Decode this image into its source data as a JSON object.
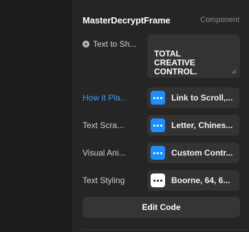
{
  "header": {
    "frame_name": "MasterDecryptFrame",
    "frame_type": "Component"
  },
  "text_row": {
    "label": "Text to Sh...",
    "value": "TOTAL\nCREATIVE\nCONTROL."
  },
  "rows": [
    {
      "label": "How It Pla...",
      "value": "Link to Scroll,..."
    },
    {
      "label": "Text Scra...",
      "value": "Letter, Chines..."
    },
    {
      "label": "Visual Ani...",
      "value": "Custom Contr..."
    },
    {
      "label": "Text Styling",
      "value": "Boorne, 64, 6..."
    }
  ],
  "edit_button": {
    "label": "Edit Code"
  },
  "colors": {
    "accent": "#1e8eff",
    "link_label": "#3a9bff",
    "panel": "#252525"
  },
  "icons": {
    "plus": "plus-circle-icon",
    "more": "more-dots-icon",
    "resize": "resize-handle-icon"
  }
}
